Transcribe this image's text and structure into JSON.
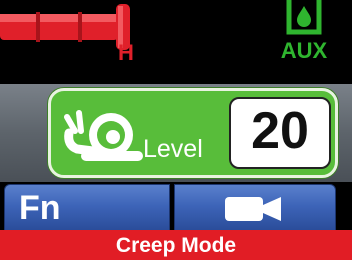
{
  "status": {
    "gauge_letter": "H",
    "aux_label": "AUX",
    "icons": {
      "gauge": "hydraulic-gauge-icon",
      "aux": "aux-fluid-icon"
    }
  },
  "creep": {
    "label": "Level",
    "value": "20",
    "icon": "snail-icon",
    "color": "#58bd3a"
  },
  "buttons": {
    "fn_label": "Fn",
    "camera_icon": "camera-icon",
    "color": "#3d64b8"
  },
  "mode": {
    "text": "Creep Mode",
    "color": "#e11d25"
  }
}
